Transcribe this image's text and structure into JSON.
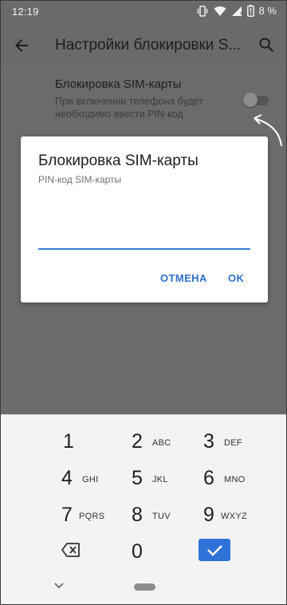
{
  "status_bar": {
    "time": "12:19",
    "battery_percent": "8 %",
    "icons": [
      "vibrate-icon",
      "wifi-icon",
      "signal-icon",
      "battery-icon"
    ]
  },
  "app_bar": {
    "title": "Настройки блокировки S...",
    "back_icon": "arrow-back-icon",
    "search_icon": "search-icon"
  },
  "setting": {
    "title": "Блокировка SIM-карты",
    "subtitle_line1": "При включении телефона будет",
    "subtitle_line2": "необходимо ввести PIN-код",
    "toggle_on": false
  },
  "dialog": {
    "title": "Блокировка SIM-карты",
    "subtitle": "PIN-код SIM-карты",
    "pin_value": "",
    "cancel_label": "ОТМЕНА",
    "ok_label": "OK",
    "accent_color": "#2f6fc9"
  },
  "keyboard": {
    "keys": [
      {
        "digit": "1",
        "letters": ""
      },
      {
        "digit": "2",
        "letters": "ABC"
      },
      {
        "digit": "3",
        "letters": "DEF"
      },
      {
        "digit": "4",
        "letters": "GHI"
      },
      {
        "digit": "5",
        "letters": "JKL"
      },
      {
        "digit": "6",
        "letters": "MNO"
      },
      {
        "digit": "7",
        "letters": "PQRS"
      },
      {
        "digit": "8",
        "letters": "TUV"
      },
      {
        "digit": "9",
        "letters": "WXYZ"
      },
      {
        "digit": "0",
        "letters": ""
      }
    ],
    "backspace_icon": "backspace-icon",
    "confirm_icon": "checkmark-icon",
    "confirm_color": "#2f73d8"
  },
  "nav_bar": {
    "back_icon": "chevron-down-icon",
    "home_icon": "home-pill-icon"
  }
}
